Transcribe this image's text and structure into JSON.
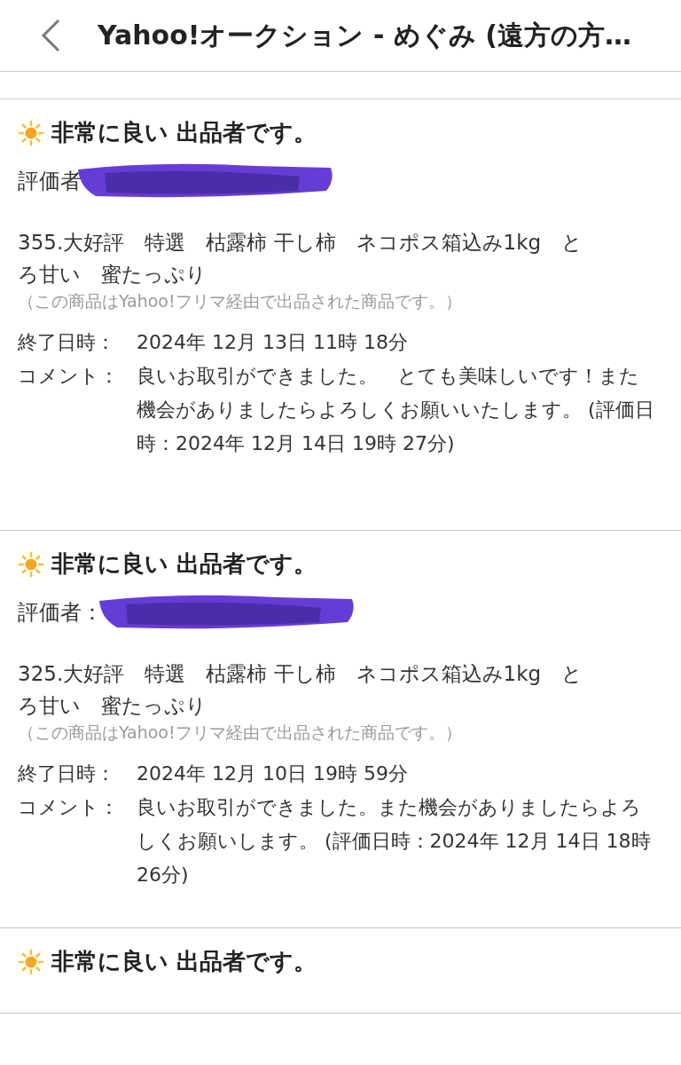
{
  "header": {
    "title": "Yahoo!オークション - めぐみ (遠方の方…"
  },
  "reviews": [
    {
      "rating": "非常に良い 出品者です。",
      "reviewer_label": "評価者",
      "reviewer_redacted": true,
      "item": "355.大好評　特選　枯露柿 干し柿　ネコポス箱込み1kg　とろ甘い　蜜たっぷり",
      "note": "（この商品はYahoo!フリマ経由で出品された商品です。）",
      "fields": [
        {
          "label": "終了日時：",
          "value": "2024年 12月 13日 11時 18分"
        },
        {
          "label": "コメント：",
          "value": "良いお取引ができました。　とても美味しいです！また機会がありましたらよろしくお願いいたします。 (評価日時：2024年 12月 14日 19時 27分)"
        }
      ]
    },
    {
      "rating": "非常に良い 出品者です。",
      "reviewer_label": "評価者：",
      "reviewer_redacted": true,
      "item": "325.大好評　特選　枯露柿 干し柿　ネコポス箱込み1kg　とろ甘い　蜜たっぷり",
      "note": "（この商品はYahoo!フリマ経由で出品された商品です。）",
      "fields": [
        {
          "label": "終了日時：",
          "value": "2024年 12月 10日 19時 59分"
        },
        {
          "label": "コメント：",
          "value": "良いお取引ができました。また機会がありましたらよろしくお願いします。 (評価日時：2024年 12月 14日 18時 26分)"
        }
      ]
    },
    {
      "rating": "非常に良い 出品者です。"
    }
  ]
}
